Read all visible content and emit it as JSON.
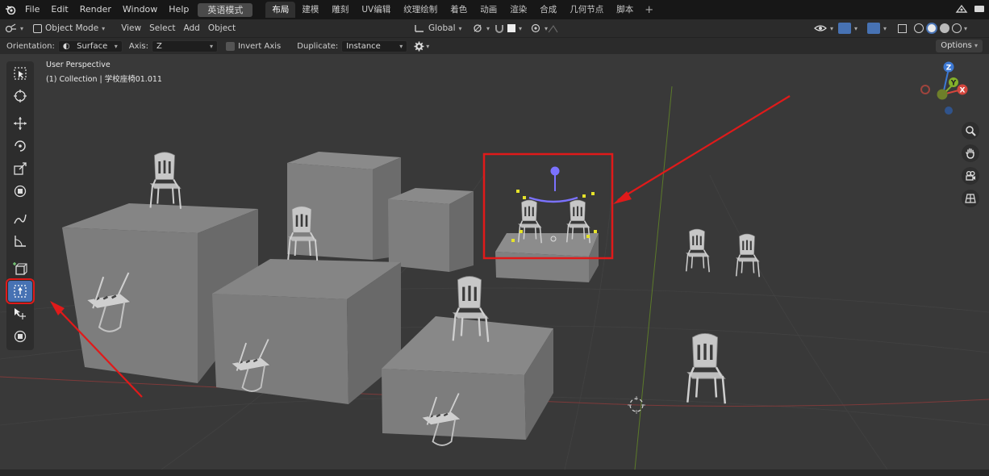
{
  "menu": {
    "items": [
      "File",
      "Edit",
      "Render",
      "Window",
      "Help"
    ],
    "mode_button": "英语模式"
  },
  "workspaces": {
    "tabs": [
      "布局",
      "建模",
      "雕刻",
      "UV编辑",
      "纹理绘制",
      "着色",
      "动画",
      "渲染",
      "合成",
      "几何节点",
      "脚本"
    ],
    "add": "+"
  },
  "header": {
    "mode": "Object Mode",
    "menus": [
      "View",
      "Select",
      "Add",
      "Object"
    ],
    "transform_orientation": "Global"
  },
  "tool_settings": {
    "orientation_label": "Orientation:",
    "orientation_value": "Surface",
    "axis_label": "Axis:",
    "axis_value": "Z",
    "invert_axis": "Invert Axis",
    "duplicate_label": "Duplicate:",
    "duplicate_value": "Instance",
    "options": "Options"
  },
  "viewport": {
    "perspective": "User Perspective",
    "collection_info": "(1) Collection | 学校座椅01.011"
  },
  "gizmo": {
    "x": "X",
    "y": "Y",
    "z": "Z"
  },
  "colors": {
    "accent": "#4772b3",
    "highlight_red": "#e01a1a",
    "axis_x": "#d4463d",
    "axis_y": "#84b02a",
    "axis_z": "#3d79d4"
  }
}
